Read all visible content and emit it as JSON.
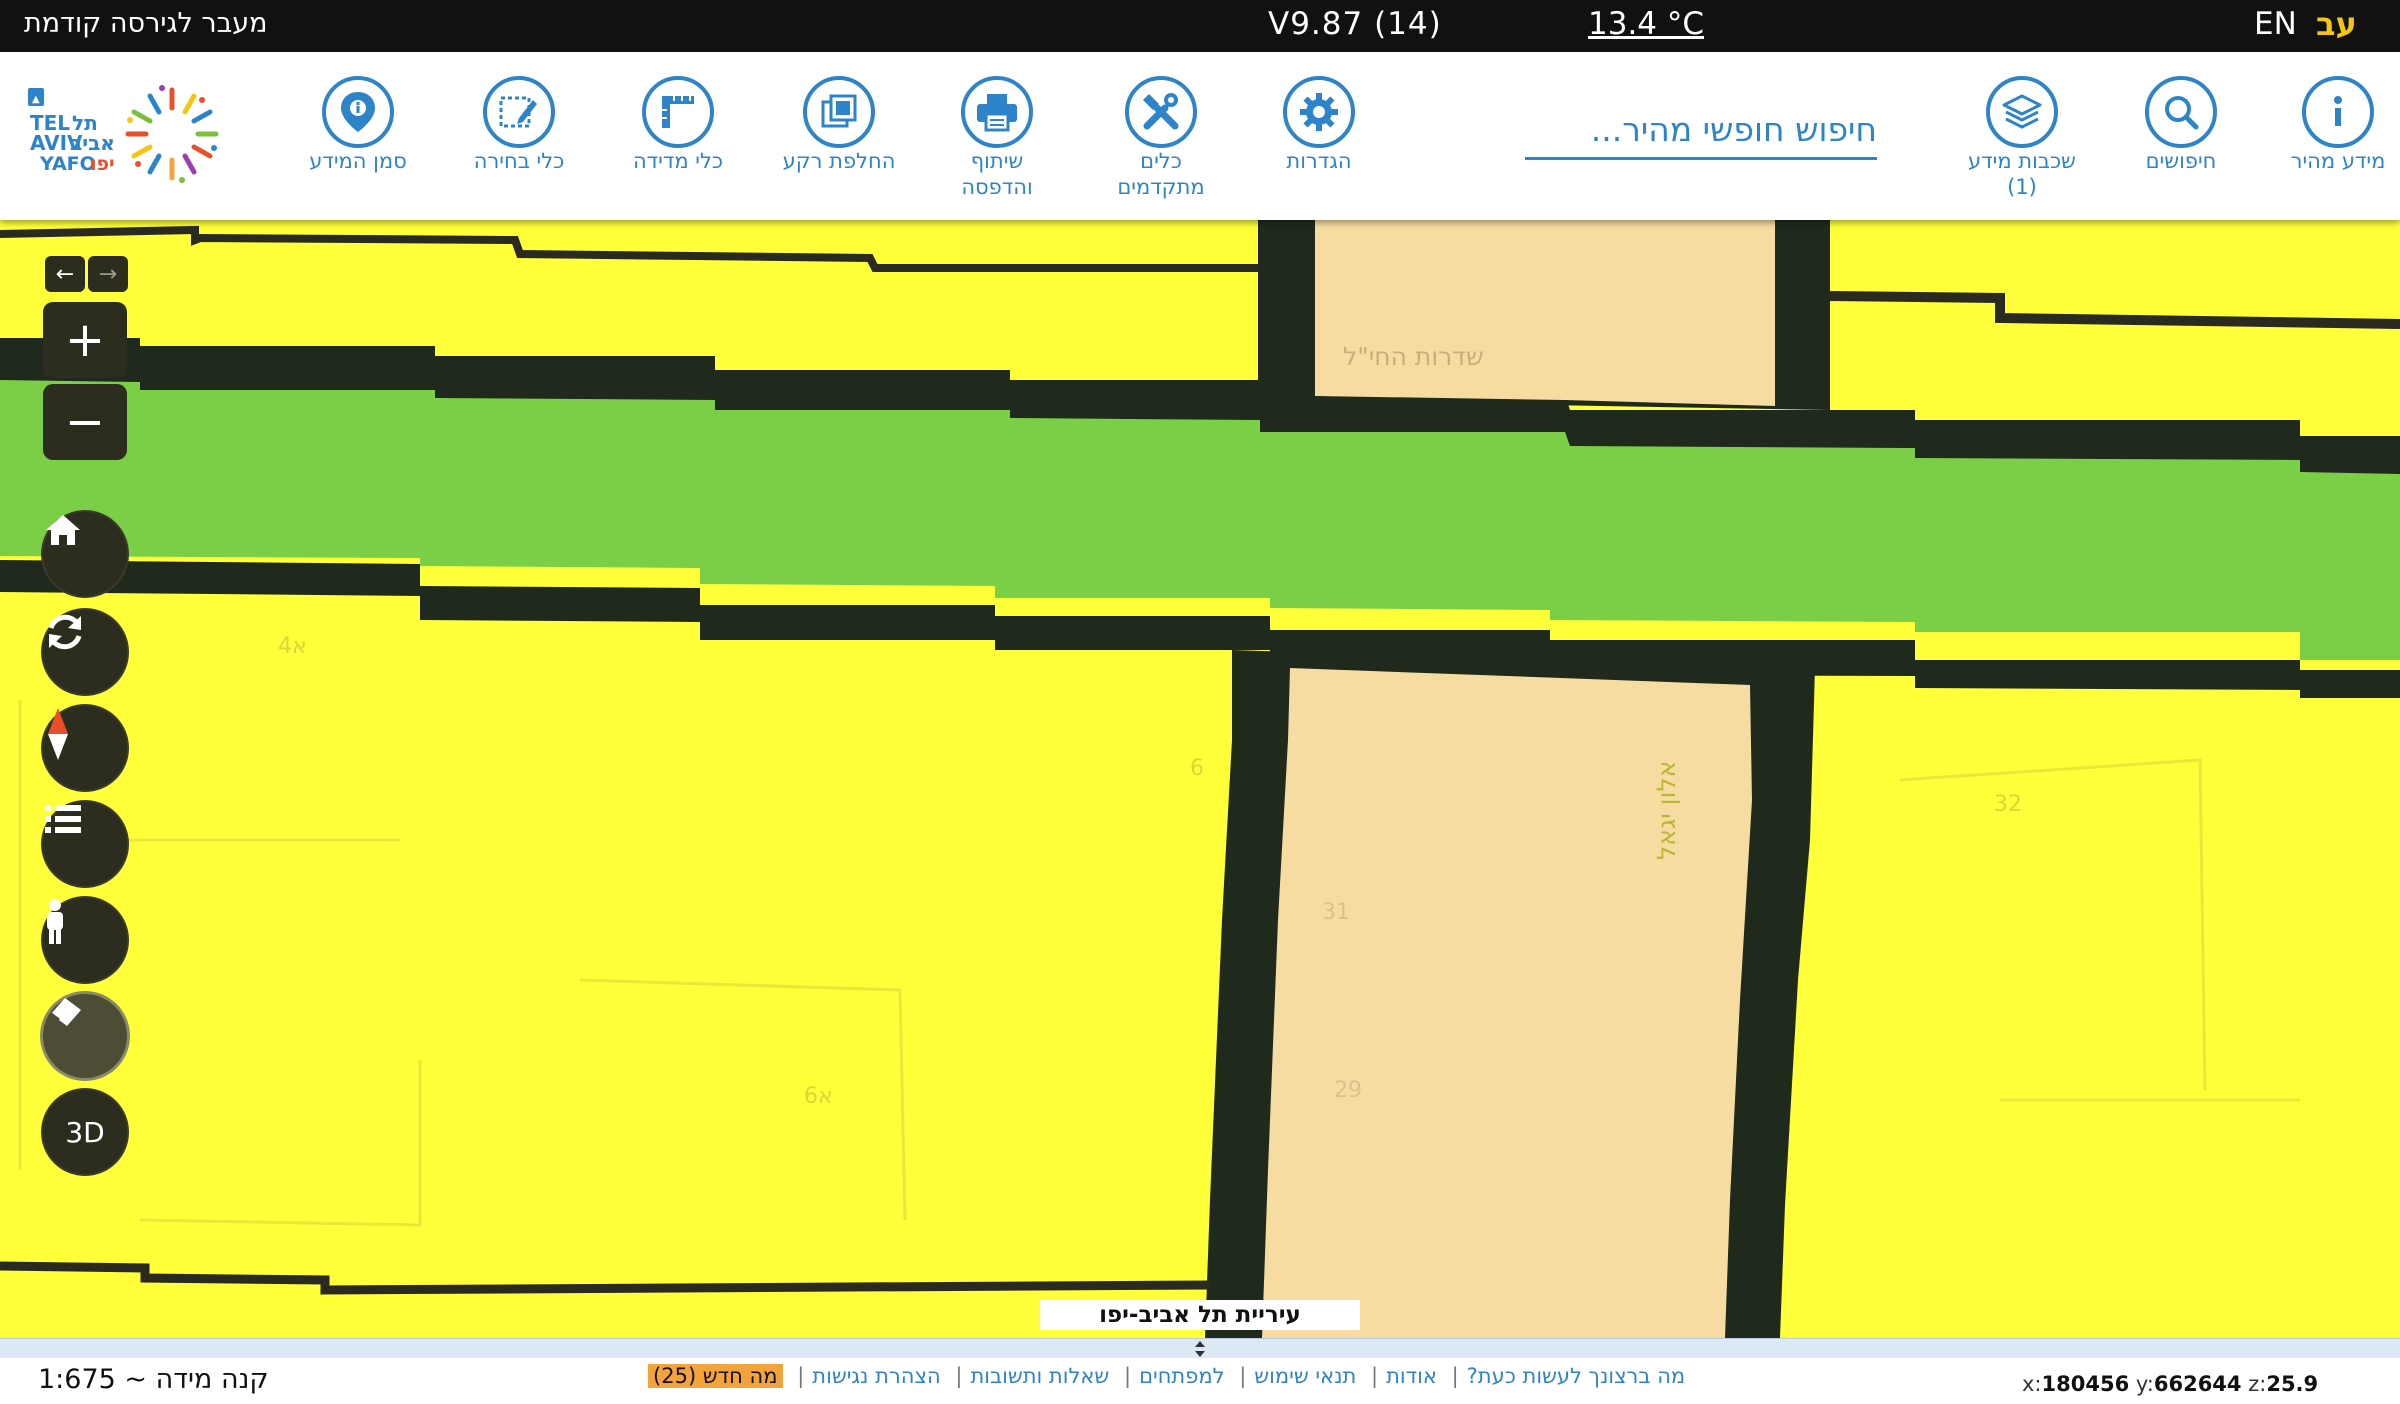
{
  "topbar": {
    "previous_version": "מעבר לגירסה קודמת",
    "version": "V9.87 (14)",
    "temperature": "13.4 °C",
    "lang_en": "EN",
    "lang_he": "עב"
  },
  "toolbar": {
    "quick_info": "מידע מהיר",
    "searches": "חיפושים",
    "layers": "שכבות מידע\n(1)",
    "search_placeholder": "חיפוש חופשי מהיר...",
    "settings": "הגדרות",
    "advanced_tools": "כלים\nמתקדמים",
    "share_print": "שיתוף\nוהדפסה",
    "basemap": "החלפת רקע",
    "measure": "כלי מדידה",
    "select": "כלי בחירה",
    "mark_info": "סמן המידע"
  },
  "logo": {
    "he_text": "תל אביב יפו",
    "en_text": "TEL AVIV YAFO"
  },
  "map": {
    "zoom_in": "+",
    "zoom_out": "−",
    "btn_3d": "3D",
    "street_label_1": "שדרות החי\"ל",
    "street_label_2": "אלון יגאל",
    "parcel_labels": [
      "א4",
      "6",
      "31",
      "29",
      "א6",
      "32"
    ],
    "city_label": "עיריית תל אביב-יפו"
  },
  "bottombar": {
    "scale": "קנה מידה ~ 1:675",
    "links": {
      "what_to_do": "מה ברצונך לעשות כעת?",
      "about": "אודות",
      "terms": "תנאי שימוש",
      "developers": "למפתחים",
      "faq": "שאלות ותשובות",
      "accessibility": "הצהרת נגישות",
      "whats_new": "מה חדש (25)"
    },
    "coords": {
      "x_label": "x:",
      "x": "180456",
      "y_label": "y:",
      "y": "662644",
      "z_label": "z:",
      "z": "25.9"
    }
  },
  "colors": {
    "accent": "#2e84c8",
    "map_zone_yellow": "#ffff3a",
    "map_green_corridor": "#7bcf46",
    "map_parcel_peach": "#f6dca0",
    "map_dark_road": "#1f2a1d",
    "whats_new_badge": "#f3a33c"
  }
}
